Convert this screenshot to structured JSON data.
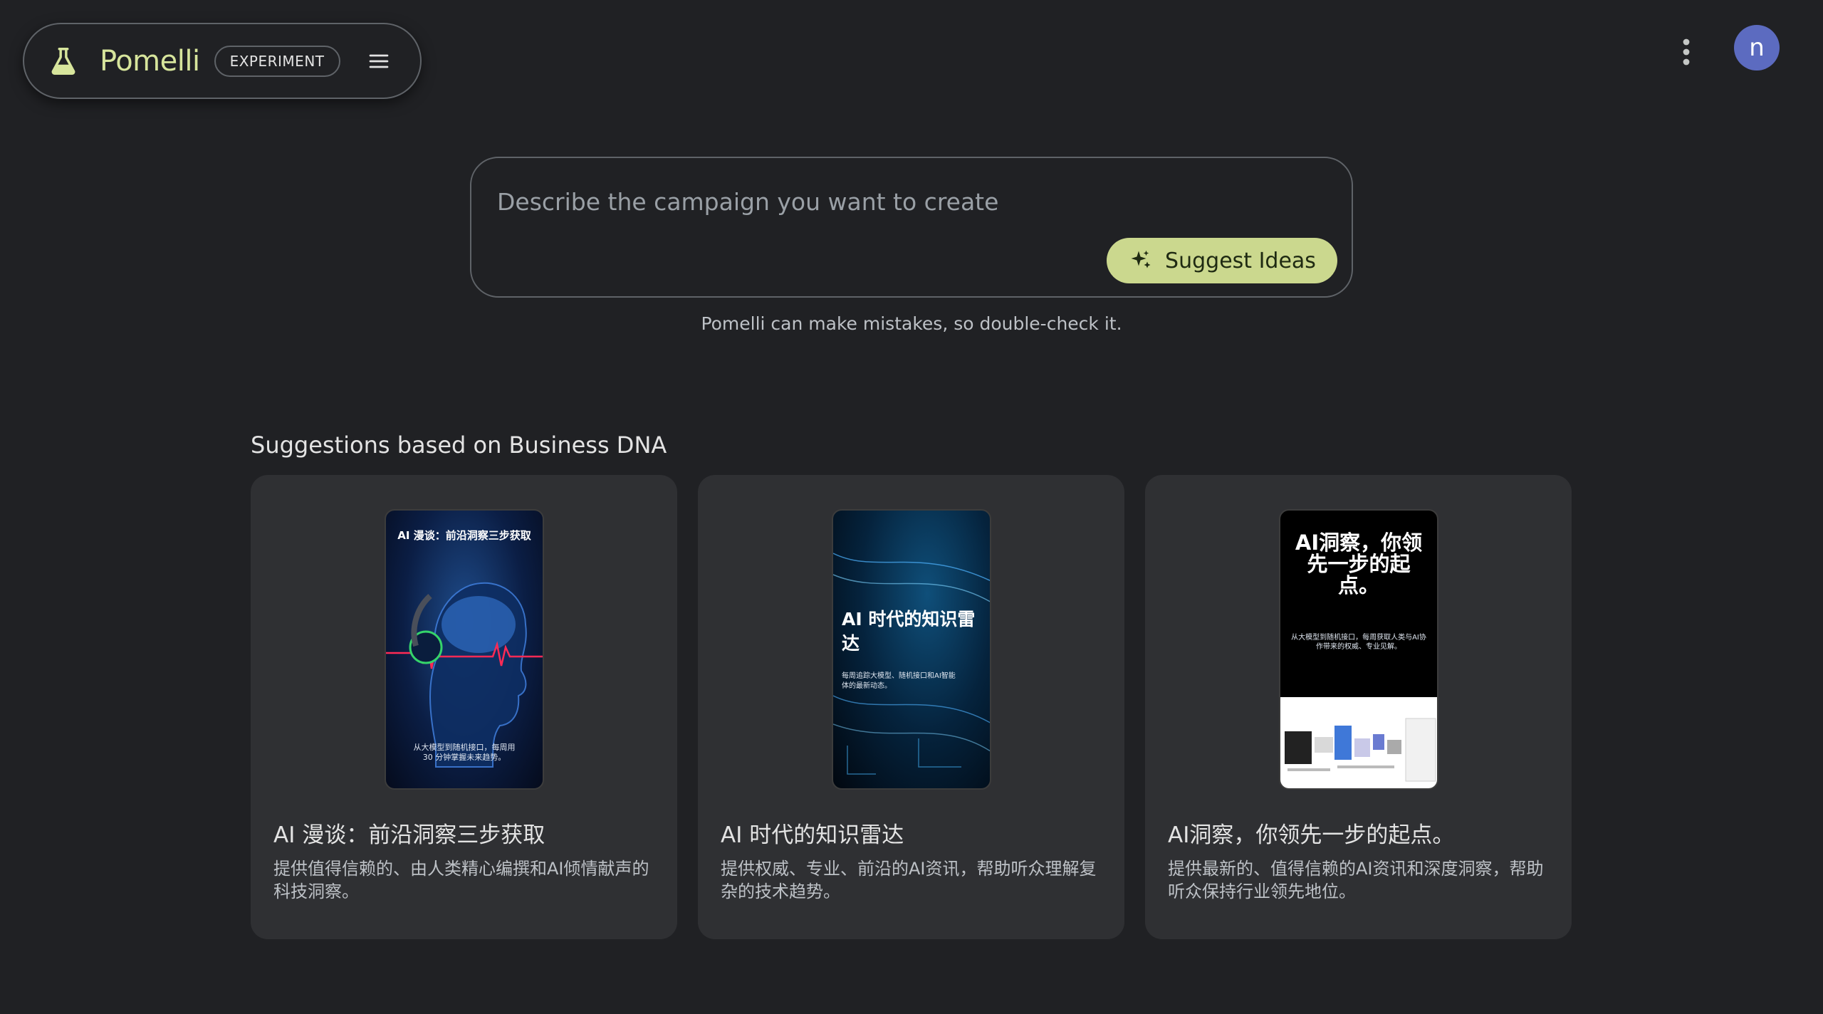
{
  "brand": {
    "name": "Pomelli",
    "badge": "EXPERIMENT",
    "accent_color": "#d7e59c"
  },
  "user": {
    "avatar_initial": "n",
    "avatar_color": "#5c6bc0"
  },
  "prompt": {
    "placeholder": "Describe the campaign you want to create",
    "suggest_label": "Suggest Ideas",
    "disclaimer": "Pomelli can make mistakes, so double-check it."
  },
  "suggestions": {
    "title": "Suggestions based on Business DNA",
    "cards": [
      {
        "title": "AI 漫谈：前沿洞察三步获取",
        "description": "提供值得信赖的、由人类精心编撰和AI倾情献声的科技洞察。",
        "thumb_heading": "AI 漫谈：前沿洞察三步获取",
        "thumb_sub": "从大模型到随机接口，每周用 30 分钟掌握未来趋势。"
      },
      {
        "title": "AI 时代的知识雷达",
        "description": "提供权威、专业、前沿的AI资讯，帮助听众理解复杂的技术趋势。",
        "thumb_heading": "AI 时代的知识雷达",
        "thumb_sub": "每周追踪大模型、随机接口和AI智能体的最新动态。"
      },
      {
        "title": "AI洞察，你领先一步的起点。",
        "description": "提供最新的、值得信赖的AI资讯和深度洞察，帮助听众保持行业领先地位。",
        "thumb_heading": "AI洞察，你领先一步的起点。",
        "thumb_sub": "从大模型到随机接口，每周获取人类与AI协作带来的权威、专业见解。"
      }
    ]
  },
  "icons": {
    "brand": "flask-icon",
    "menu": "hamburger-menu-icon",
    "more": "more-vert-icon",
    "suggest": "sparkle-icon"
  }
}
